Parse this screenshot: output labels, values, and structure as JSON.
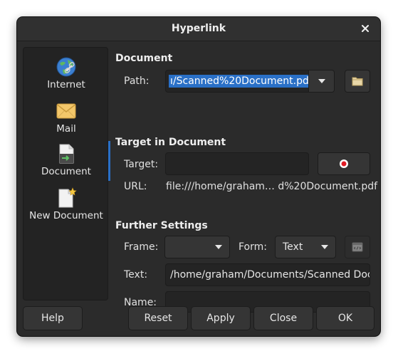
{
  "window": {
    "title": "Hyperlink"
  },
  "sidebar": {
    "items": [
      {
        "label": "Internet",
        "icon": "globe-link-icon"
      },
      {
        "label": "Mail",
        "icon": "envelope-icon"
      },
      {
        "label": "Document",
        "icon": "document-link-icon"
      },
      {
        "label": "New Document",
        "icon": "new-document-icon"
      }
    ],
    "selected": "Document"
  },
  "document": {
    "section_title": "Document",
    "path_label": "Path:",
    "path_value": "ı/Scanned%20Document.pdf"
  },
  "target": {
    "section_title": "Target in Document",
    "target_label": "Target:",
    "target_value": "",
    "url_label": "URL:",
    "url_value": "file:///home/graham… d%20Document.pdf"
  },
  "further": {
    "section_title": "Further Settings",
    "frame_label": "Frame:",
    "frame_value": "",
    "form_label": "Form:",
    "form_value": "Text",
    "text_label": "Text:",
    "text_value": "/home/graham/Documents/Scanned Docu",
    "name_label": "Name:",
    "name_value": ""
  },
  "buttons": {
    "help": "Help",
    "reset": "Reset",
    "apply": "Apply",
    "close": "Close",
    "ok": "OK"
  },
  "colors": {
    "window_bg": "#2b2b2b",
    "selection": "#2a70c7",
    "accent_red": "#e01b24"
  }
}
